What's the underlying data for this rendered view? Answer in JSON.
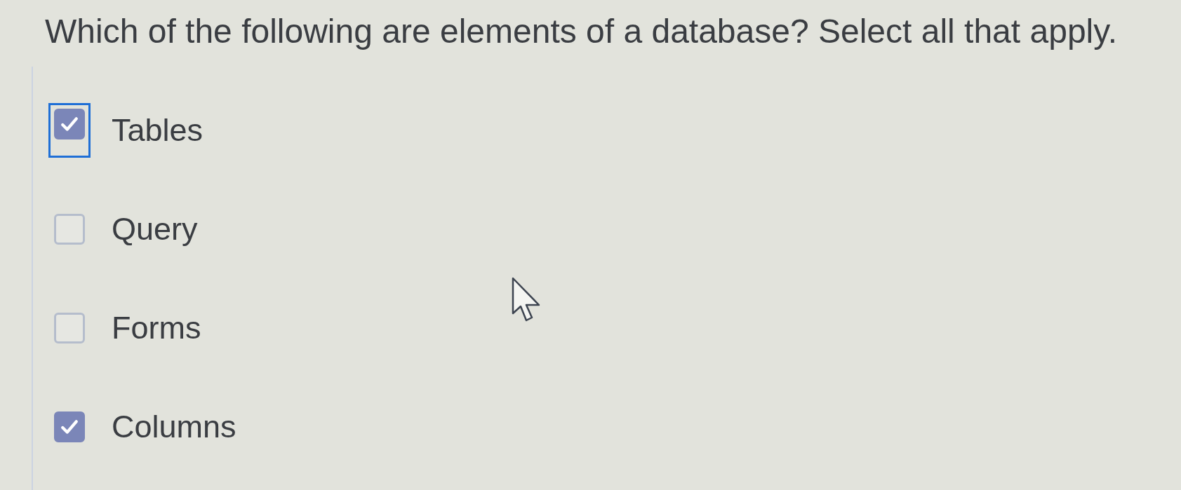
{
  "question": {
    "text": "Which of the following are elements of a database? Select all that apply."
  },
  "options": [
    {
      "label": "Tables",
      "checked": true,
      "focused": true
    },
    {
      "label": "Query",
      "checked": false,
      "focused": false
    },
    {
      "label": "Forms",
      "checked": false,
      "focused": false
    },
    {
      "label": "Columns",
      "checked": true,
      "focused": false
    }
  ]
}
